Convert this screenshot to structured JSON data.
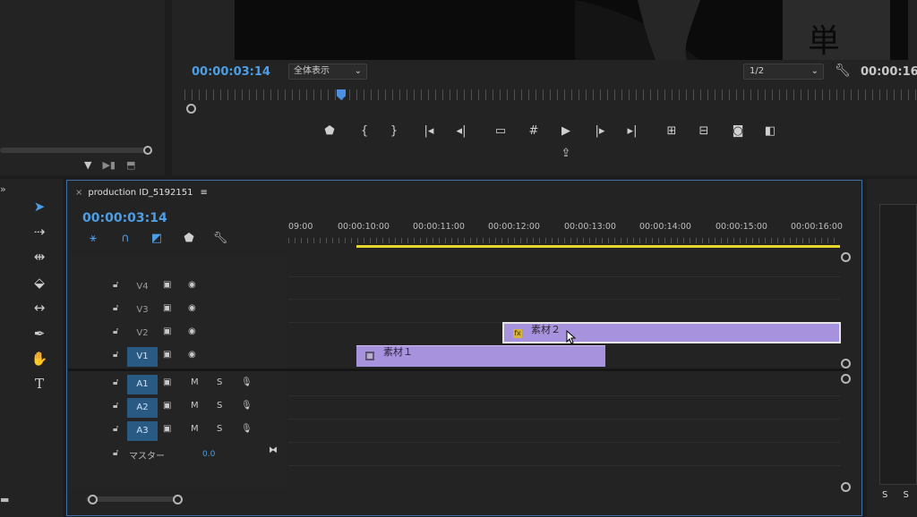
{
  "program_monitor": {
    "timecode": "00:00:03:14",
    "fit": "全体表示",
    "resolution": "1/2",
    "duration": "00:00:16:",
    "transport_icons": [
      "marker-icon",
      "mark-in-icon",
      "mark-out-icon",
      "go-to-in-icon",
      "step-back-icon",
      "safe-margins-icon",
      "grid-icon",
      "play-icon",
      "step-forward-icon",
      "go-to-out-icon",
      "insert-icon",
      "overwrite-icon",
      "export-frame-icon",
      "compare-icon",
      "export-icon"
    ]
  },
  "timeline": {
    "sequence_name": "production ID_5192151",
    "timecode": "00:00:03:14",
    "ruler": [
      "09:00",
      "00:00:10:00",
      "00:00:11:00",
      "00:00:12:00",
      "00:00:13:00",
      "00:00:14:00",
      "00:00:15:00",
      "00:00:16:00"
    ],
    "video_tracks": [
      "V4",
      "V3",
      "V2",
      "V1"
    ],
    "audio_tracks": [
      "A1",
      "A2",
      "A3"
    ],
    "audio_buttons": {
      "mute": "M",
      "solo": "S"
    },
    "master_label": "マスター",
    "master_value": "0.0",
    "clips": [
      {
        "name": "素材２",
        "track": "V2",
        "badge": "fx"
      },
      {
        "name": "素材１",
        "track": "V1",
        "badge": "▦"
      }
    ]
  },
  "right_panel": {
    "label": "S"
  },
  "colors": {
    "accent": "#4c9ee6",
    "clip": "#a792dd",
    "work_area": "#e6d52c",
    "selection_border": "#3f6fa6"
  }
}
